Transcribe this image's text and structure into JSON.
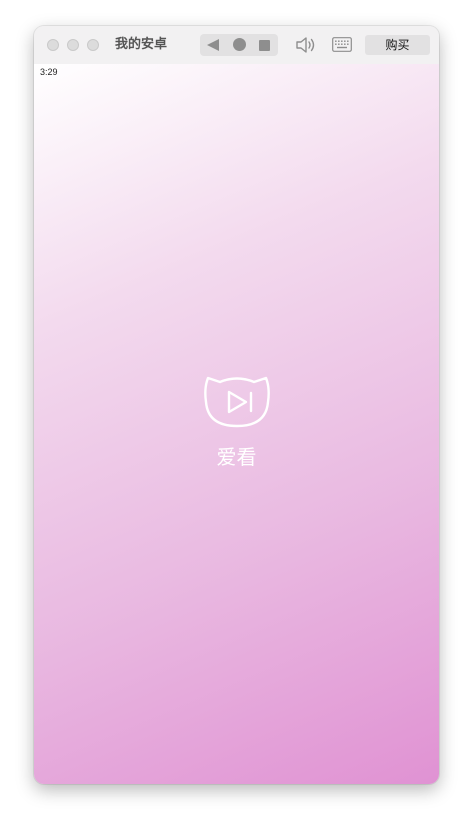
{
  "window": {
    "title": "我的安卓",
    "buy_label": "购买"
  },
  "toolbar": {
    "back_icon": "back-triangle-icon",
    "home_icon": "home-circle-icon",
    "recent_icon": "recent-square-icon",
    "volume_icon": "volume-icon",
    "keyboard_icon": "keyboard-icon"
  },
  "status_bar": {
    "time": "3:29"
  },
  "splash": {
    "app_name": "爱看",
    "logo_icon": "cat-play-logo-icon"
  },
  "colors": {
    "gradient_start": "#ffffff",
    "gradient_end": "#e092d3",
    "titlebar_bg": "#f2f1f2"
  }
}
